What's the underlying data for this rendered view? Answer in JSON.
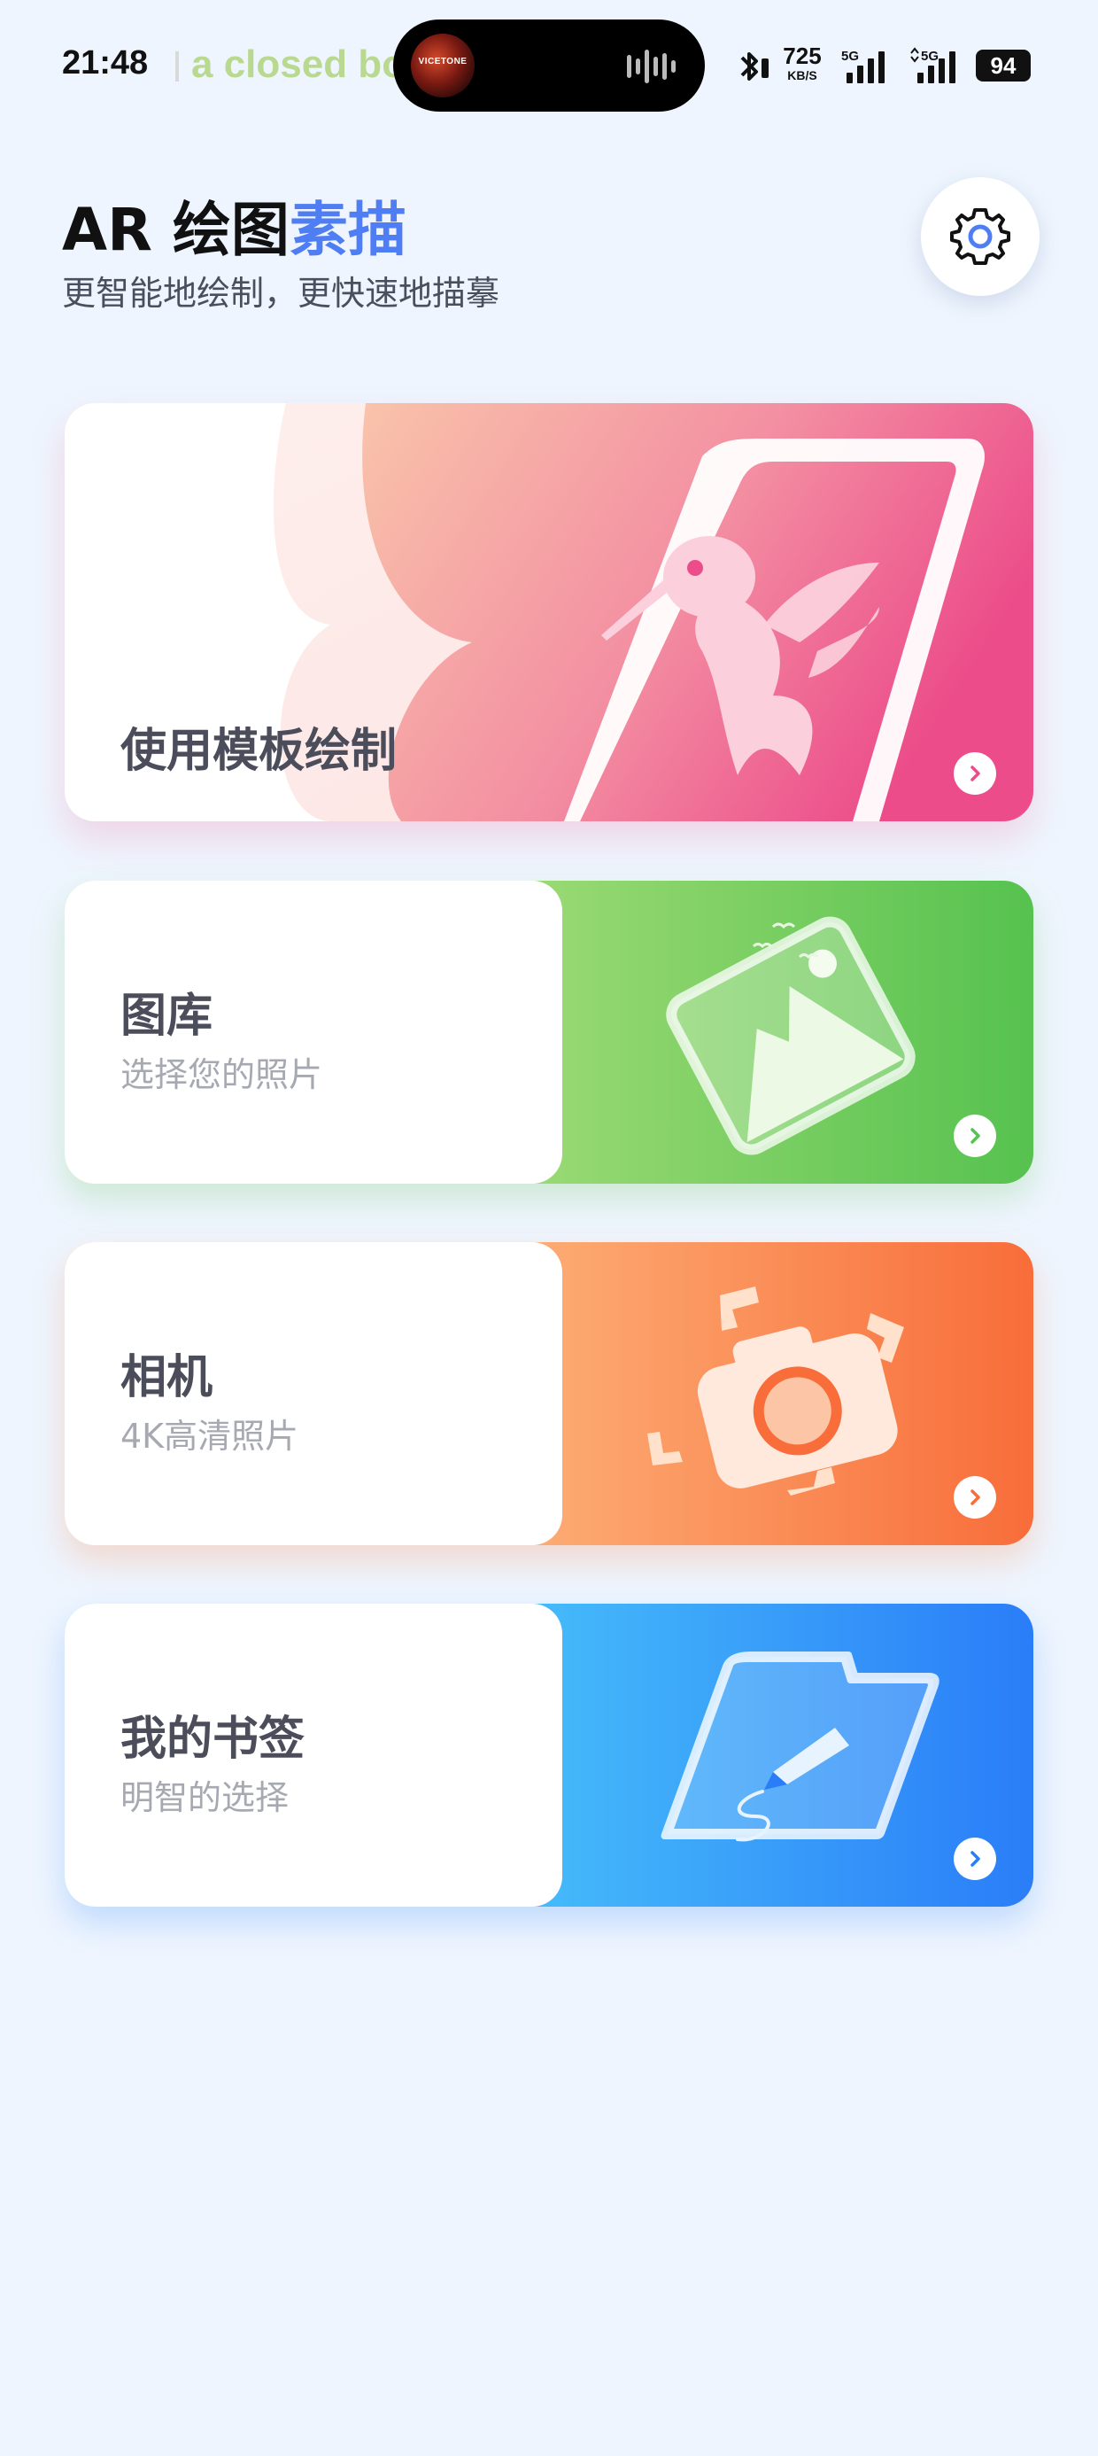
{
  "status_bar": {
    "time": "21:48",
    "media_text": "a closed bo",
    "album_art_text": "VICETONE",
    "network_speed": "725",
    "network_unit": "KB/S",
    "signal1_label": "5G",
    "signal2_label": "5G",
    "battery": "94"
  },
  "header": {
    "title_main": "AR 绘图",
    "title_accent": "素描",
    "subtitle": "更智能地绘制，更快速地描摹",
    "settings_icon": "gear-icon"
  },
  "cards": {
    "template": {
      "title": "使用模板绘制",
      "icon": "chevron-right-icon"
    },
    "gallery": {
      "title": "图库",
      "subtitle": "选择您的照片",
      "icon": "chevron-right-icon"
    },
    "camera": {
      "title": "相机",
      "subtitle": "4K高清照片",
      "icon": "chevron-right-icon"
    },
    "bookmark": {
      "title": "我的书签",
      "subtitle": "明智的选择",
      "icon": "chevron-right-icon"
    }
  },
  "colors": {
    "background": "#eef5fe",
    "accent": "#4f7df3",
    "template_gradient": [
      "#f8b9a4",
      "#ee5a8c"
    ],
    "gallery_gradient": [
      "#c9ec94",
      "#56c24f"
    ],
    "camera_gradient": [
      "#ffd29a",
      "#f86d3a"
    ],
    "bookmark_gradient": [
      "#6fe0ff",
      "#2a7df8"
    ]
  }
}
